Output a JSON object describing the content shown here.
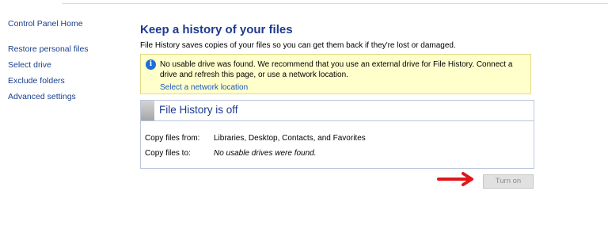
{
  "sidebar": {
    "home": "Control Panel Home",
    "items": [
      {
        "label": "Restore personal files"
      },
      {
        "label": "Select drive"
      },
      {
        "label": "Exclude folders"
      },
      {
        "label": "Advanced settings"
      }
    ]
  },
  "main": {
    "title": "Keep a history of your files",
    "subtitle": "File History saves copies of your files so you can get them back if they're lost or damaged.",
    "notice": {
      "icon": "info-icon",
      "message": "No usable drive was found. We recommend that you use an external drive for File History. Connect a drive and refresh this page, or use a network location.",
      "link": "Select a network location"
    },
    "status": {
      "title": "File History is off",
      "rows": [
        {
          "label": "Copy files from:",
          "value": "Libraries, Desktop, Contacts, and Favorites"
        },
        {
          "label": "Copy files to:",
          "value": "No usable drives were found."
        }
      ]
    },
    "button": {
      "label": "Turn on"
    }
  },
  "colors": {
    "link": "#1a3f8c",
    "heading": "#1e3a8f",
    "notice_bg": "#ffffcc",
    "arrow": "#e0161b"
  }
}
